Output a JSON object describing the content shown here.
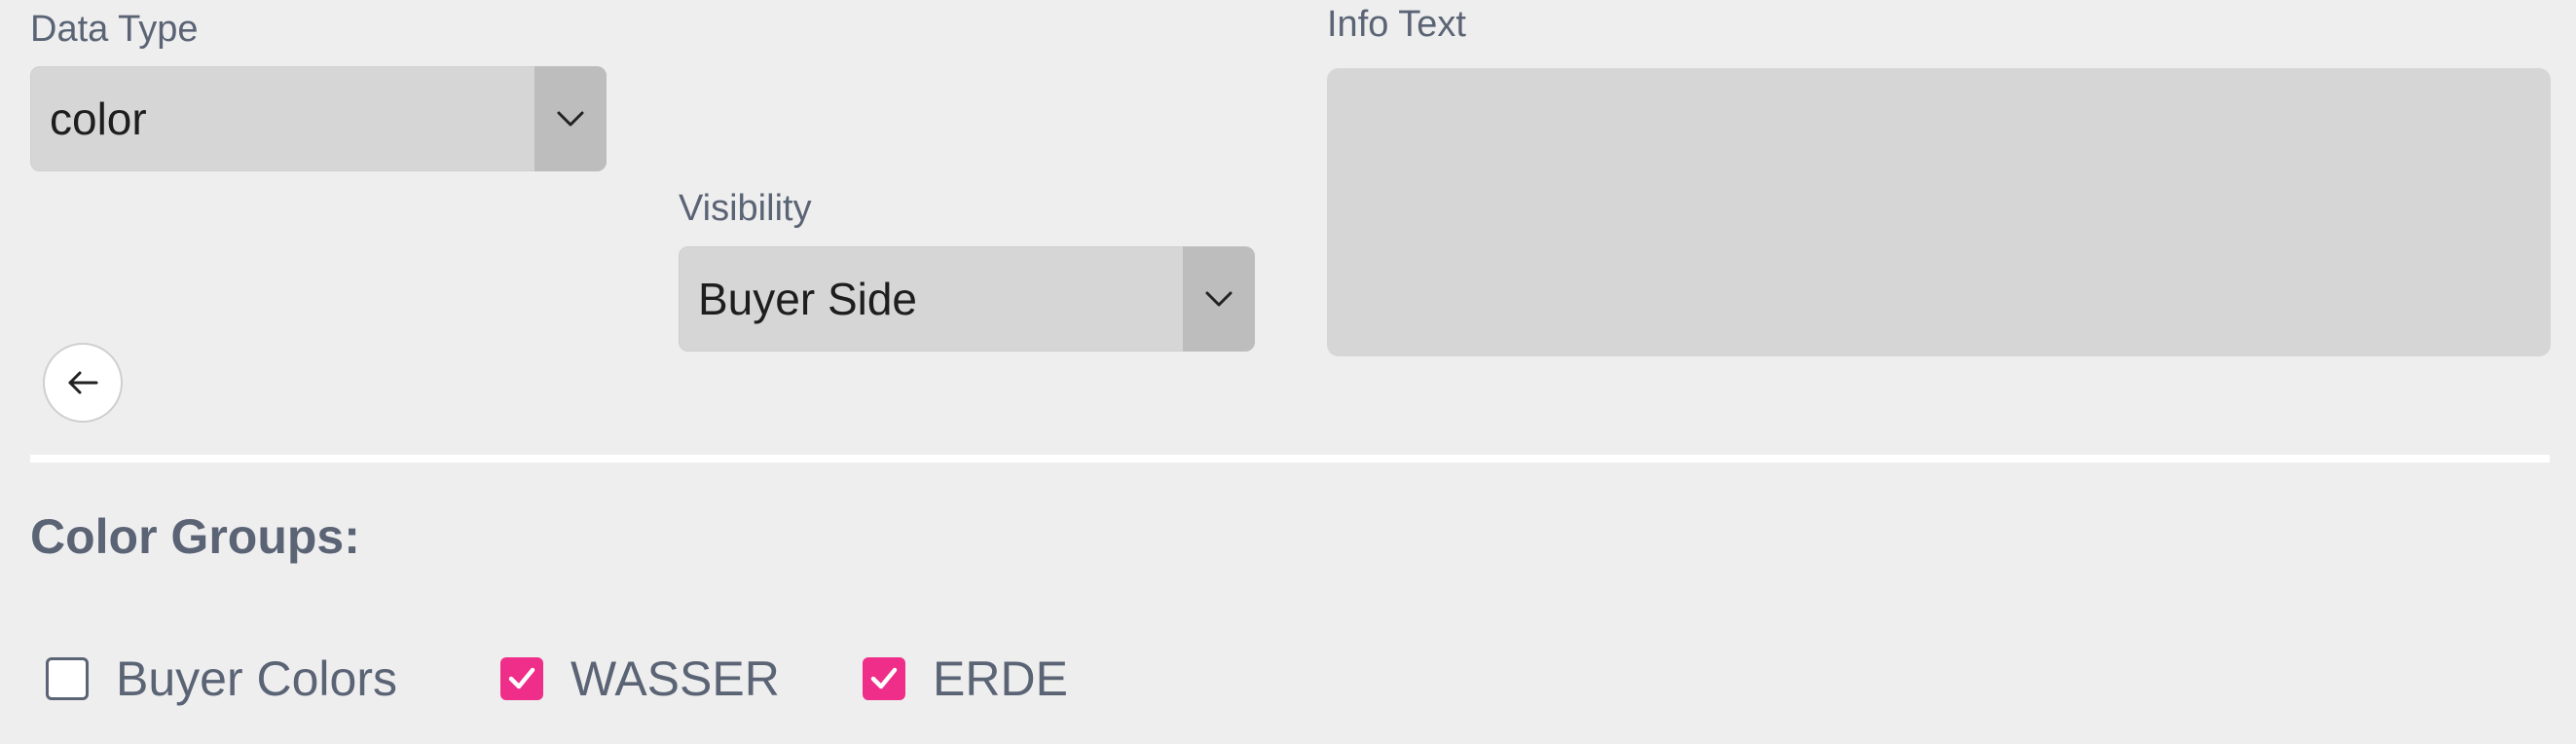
{
  "data_type": {
    "label": "Data Type",
    "value": "color",
    "arrow_icon": "chevron-down-icon"
  },
  "visibility": {
    "label": "Visibility",
    "value": "Buyer Side",
    "arrow_icon": "chevron-down-icon"
  },
  "info_text": {
    "label": "Info Text",
    "value": ""
  },
  "back_button": {
    "icon": "arrow-left-icon"
  },
  "color_groups": {
    "title": "Color Groups:",
    "items": [
      {
        "label": "Buyer Colors",
        "checked": false
      },
      {
        "label": "WASSER",
        "checked": true
      },
      {
        "label": "ERDE",
        "checked": true
      }
    ]
  },
  "colors": {
    "background": "#eeeeee",
    "field": "#d6d6d6",
    "select_arrow_bg": "#bdbdbd",
    "checkbox_checked": "#ee2e89",
    "label_text": "#5b6475"
  }
}
